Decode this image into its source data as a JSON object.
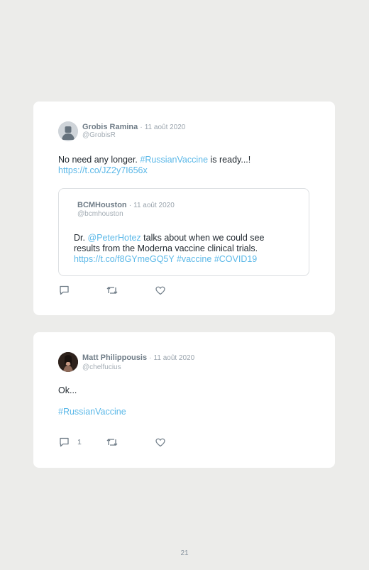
{
  "tweets": [
    {
      "author_name": "Grobis Ramina",
      "separator": "·",
      "date": "11 août 2020",
      "handle": "@GrobisR",
      "text_1": "No need any longer. ",
      "hashtag": "#RussianVaccine",
      "text_2": " is ready...!",
      "link": "https://t.co/JZ2y7I656x",
      "quoted": {
        "author_name": "BCMHouston",
        "separator": "·",
        "date": "11 août 2020",
        "handle": "@bcmhouston",
        "text_1": "Dr. ",
        "mention": "@PeterHotez",
        "text_2": " talks about when we could see",
        "text_3": "results from the Moderna vaccine clinical trials.",
        "link": "https://t.co/f8GYmeGQ5Y",
        "hashtag_1": "#vaccine",
        "hashtag_2": "#COVID19"
      },
      "reply_count": "",
      "icons": {
        "reply": "comment-icon",
        "retweet": "retweet-icon",
        "like": "heart-icon"
      }
    },
    {
      "author_name": "Matt Philippousis",
      "separator": "·",
      "date": "11 août 2020",
      "handle": "@chelfucius",
      "text_1": "Ok...",
      "hashtag": "#RussianVaccine",
      "reply_count": "1",
      "icons": {
        "reply": "comment-icon",
        "retweet": "retweet-icon",
        "like": "heart-icon"
      }
    }
  ],
  "page_number": "21",
  "colors": {
    "background": "#ececea",
    "card": "#ffffff",
    "link": "#5bb8e8",
    "name": "#6f7c87"
  }
}
